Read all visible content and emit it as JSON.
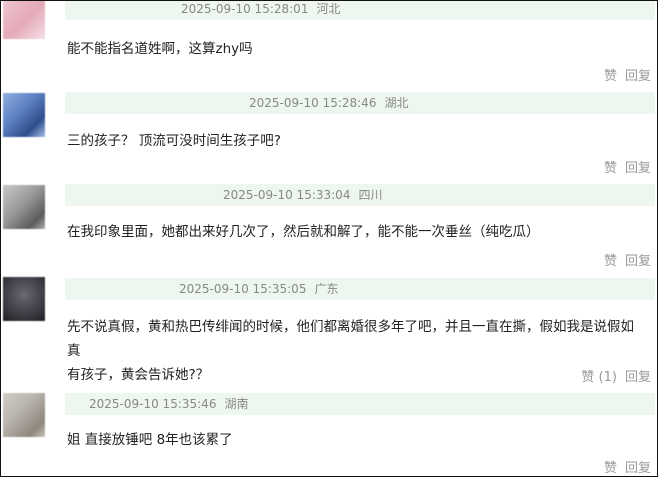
{
  "comments": [
    {
      "timestamp": "2025-09-10 15:28:01",
      "region": "河北",
      "text": "能不能指名道姓啊，这算zhy吗",
      "like_label": "赞",
      "reply_label": "回复",
      "avatar_colors": [
        "#f0c9d4",
        "#e4a9b8"
      ]
    },
    {
      "timestamp": "2025-09-10 15:28:46",
      "region": "湖北",
      "text": "三的孩子？ 顶流可没时间生孩子吧?",
      "like_label": "赞",
      "reply_label": "回复",
      "avatar_colors": [
        "#5f82c4",
        "#2f4f8c"
      ]
    },
    {
      "timestamp": "2025-09-10 15:33:04",
      "region": "四川",
      "text": "在我印象里面，她都出来好几次了，然后就和解了，能不能一次垂丝（纯吃瓜）",
      "like_label": "赞",
      "reply_label": "回复",
      "avatar_colors": [
        "#9a9a9a",
        "#5c5c5c"
      ]
    },
    {
      "timestamp": "2025-09-10 15:35:05",
      "region": "广东",
      "text_lines": [
        "先不说真假，黄和热巴传绯闻的时候，他们都离婚很多年了吧，并且一直在撕，假如我是说假如真",
        "有孩子，黄会告诉她?？"
      ],
      "like_label": "赞 (1)",
      "reply_label": "回复",
      "avatar_colors": [
        "#4a4a52",
        "#1f1f24"
      ]
    },
    {
      "timestamp": "2025-09-10 15:35:46",
      "region": "湖南",
      "text": "姐 直接放锤吧 8年也该累了",
      "like_label": "赞",
      "reply_label": "回复",
      "avatar_colors": [
        "#b9b4ac",
        "#8d877e"
      ]
    }
  ]
}
